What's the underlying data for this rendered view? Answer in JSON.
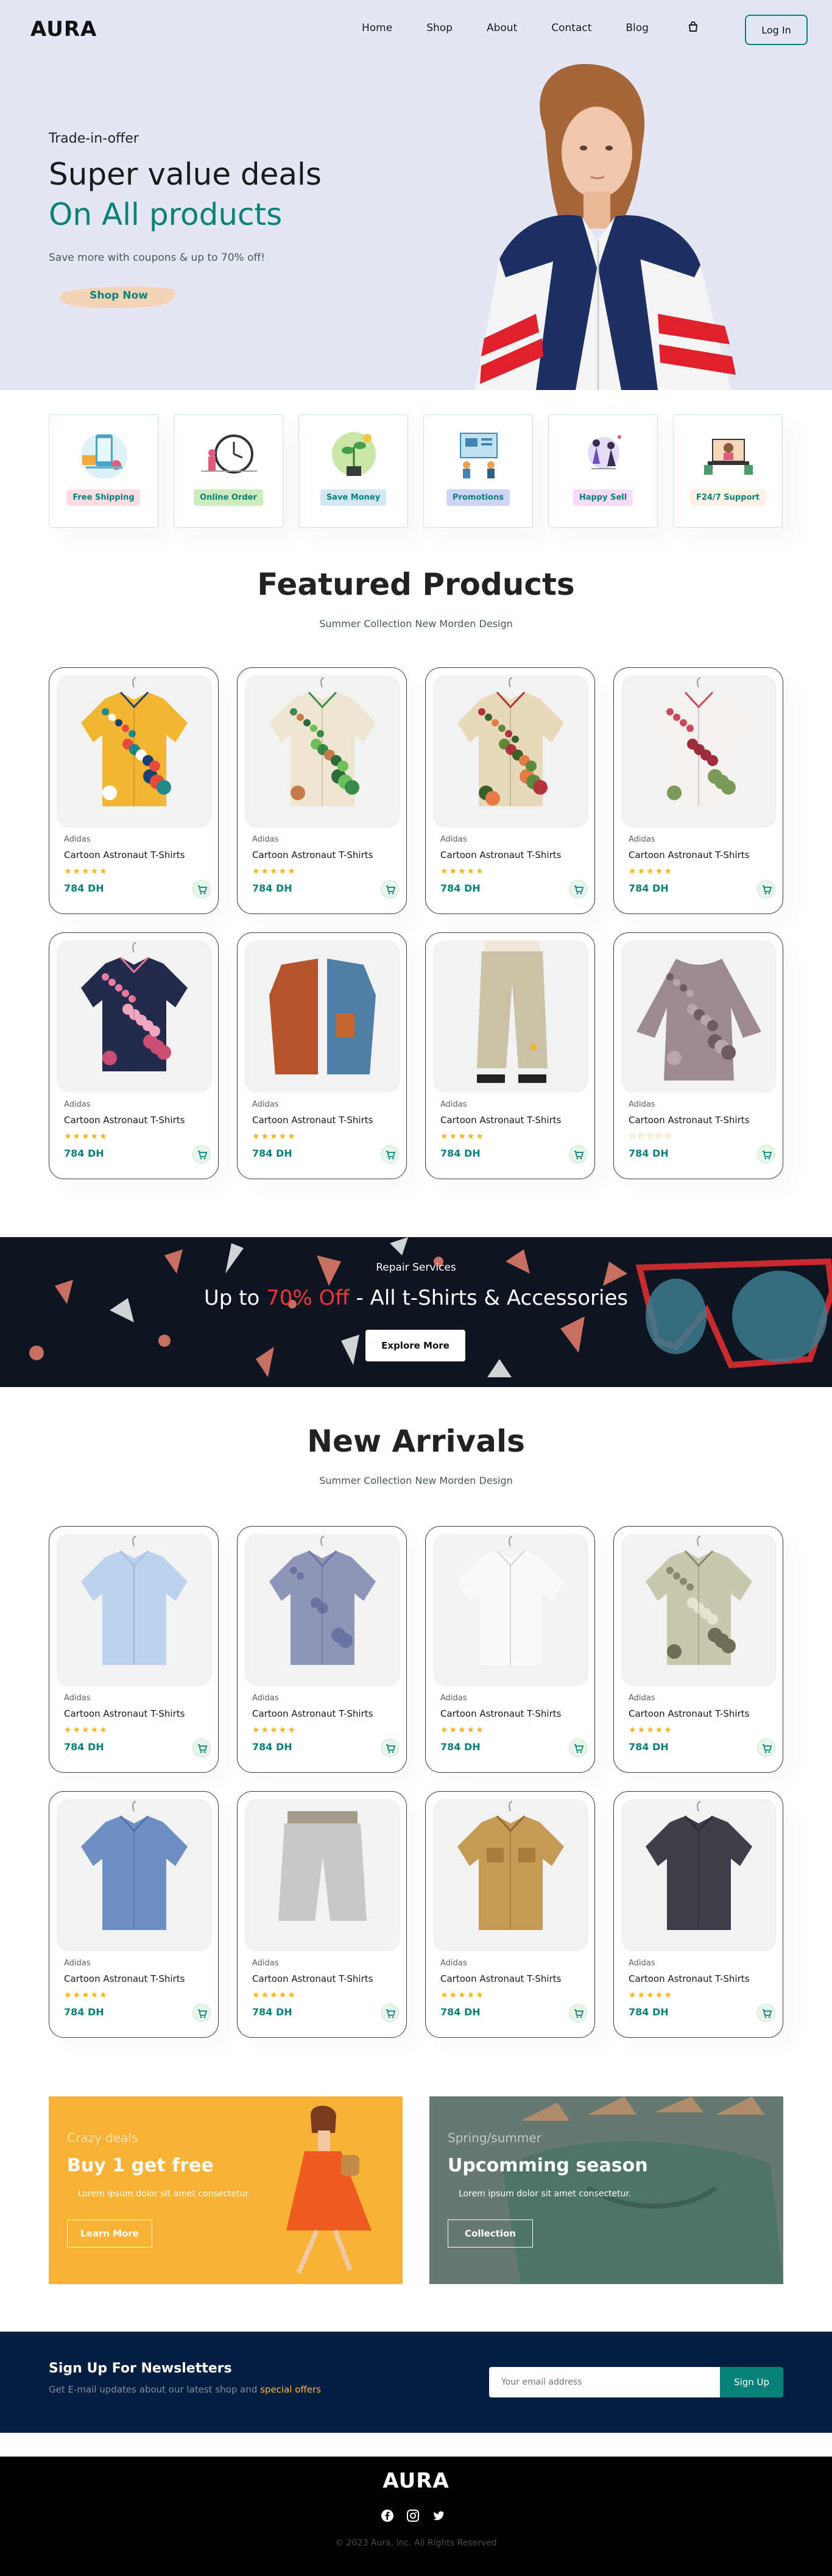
{
  "header": {
    "logo": "AURA",
    "nav": [
      "Home",
      "Shop",
      "About",
      "Contact",
      "Blog"
    ],
    "login_label": "Log In"
  },
  "hero": {
    "subtitle": "Trade-in-offer",
    "title_line1": "Super value deals",
    "title_line2": "On All products",
    "text": "Save more with coupons & up to 70% off!",
    "button": "Shop Now"
  },
  "features": [
    {
      "label": "Free Shipping",
      "bg": "#fddde4"
    },
    {
      "label": "Online Order",
      "bg": "#cdebbc"
    },
    {
      "label": "Save Money",
      "bg": "#d1e8f2"
    },
    {
      "label": "Promotions",
      "bg": "#cdd4f8"
    },
    {
      "label": "Happy Sell",
      "bg": "#f6dbf6"
    },
    {
      "label": "F24/7 Support",
      "bg": "#fff2e5"
    }
  ],
  "featured": {
    "title": "Featured Products",
    "subtitle": "Summer Collection New Morden Design",
    "products": [
      {
        "brand": "Adidas",
        "name": "Cartoon Astronaut T-Shirts",
        "stars": "★★★★★",
        "price": "784 DH",
        "icon": "shirt-yellow-teal"
      },
      {
        "brand": "Adidas",
        "name": "Cartoon Astronaut T-Shirts",
        "stars": "★★★★★",
        "price": "784 DH",
        "icon": "shirt-tropical-green"
      },
      {
        "brand": "Adidas",
        "name": "Cartoon Astronaut T-Shirts",
        "stars": "★★★★★",
        "price": "784 DH",
        "icon": "shirt-floral-beige"
      },
      {
        "brand": "Adidas",
        "name": "Cartoon Astronaut T-Shirts",
        "stars": "★★★★★",
        "price": "784 DH",
        "icon": "shirt-floral-white"
      },
      {
        "brand": "Adidas",
        "name": "Cartoon Astronaut T-Shirts",
        "stars": "★★★★★",
        "price": "784 DH",
        "icon": "shirt-navy-pink"
      },
      {
        "brand": "Adidas",
        "name": "Cartoon Astronaut T-Shirts",
        "stars": "★★★★★",
        "price": "784 DH",
        "icon": "shirt-rust-denim"
      },
      {
        "brand": "Adidas",
        "name": "Cartoon Astronaut T-Shirts",
        "stars": "★★★★★",
        "price": "784 DH",
        "icon": "pants-beige"
      },
      {
        "brand": "Adidas",
        "name": "Cartoon Astronaut T-Shirts",
        "stars": "☆☆☆☆☆",
        "price": "784 DH",
        "icon": "blouse-mauve"
      }
    ]
  },
  "banner": {
    "subtitle": "Repair Services",
    "title_pre": "Up to ",
    "title_highlight": "70% Off",
    "title_post": " - All t-Shirts & Accessories",
    "button": "Explore More"
  },
  "arrivals": {
    "title": "New Arrivals",
    "subtitle": "Summer Collection New Morden Design",
    "products": [
      {
        "brand": "Adidas",
        "name": "Cartoon Astronaut T-Shirts",
        "stars": "★★★★★",
        "price": "784 DH",
        "icon": "shirt-light-blue"
      },
      {
        "brand": "Adidas",
        "name": "Cartoon Astronaut T-Shirts",
        "stars": "★★★★★",
        "price": "784 DH",
        "icon": "shirt-blue-check"
      },
      {
        "brand": "Adidas",
        "name": "Cartoon Astronaut T-Shirts",
        "stars": "★★★★★",
        "price": "784 DH",
        "icon": "shirt-white"
      },
      {
        "brand": "Adidas",
        "name": "Cartoon Astronaut T-Shirts",
        "stars": "★★★★★",
        "price": "784 DH",
        "icon": "shirt-khaki-print"
      },
      {
        "brand": "Adidas",
        "name": "Cartoon Astronaut T-Shirts",
        "stars": "★★★★★",
        "price": "784 DH",
        "icon": "shirt-denim"
      },
      {
        "brand": "Adidas",
        "name": "Cartoon Astronaut T-Shirts",
        "stars": "★★★★★",
        "price": "784 DH",
        "icon": "shorts-grey"
      },
      {
        "brand": "Adidas",
        "name": "Cartoon Astronaut T-Shirts",
        "stars": "★★★★★",
        "price": "784 DH",
        "icon": "jacket-tan"
      },
      {
        "brand": "Adidas",
        "name": "Cartoon Astronaut T-Shirts",
        "stars": "★★★★★",
        "price": "784 DH",
        "icon": "shirt-charcoal"
      }
    ]
  },
  "promos": [
    {
      "small": "Crazy deals",
      "big": "Buy 1 get free",
      "text": "Lorem ipsum dolor sit amet consectetur.",
      "button": "Learn More"
    },
    {
      "small": "Spring/summer",
      "big": "Upcomming season",
      "text": "Lorem ipsum dolor sit amet consectetur.",
      "button": "Collection"
    }
  ],
  "newsletter": {
    "title": "Sign Up For Newsletters",
    "text_pre": "Get E-mail updates about our latest shop and ",
    "text_highlight": "special offers",
    "placeholder": "Your email address",
    "button": "Sign Up"
  },
  "footer": {
    "logo": "AURA",
    "copyright": "© 2023 Aura, Inc. All Rights Reserved"
  },
  "colors": {
    "accent": "#088178",
    "hero_bg": "#e3e6f3",
    "star": "#f3b519",
    "banner_highlight": "#ef3636",
    "newsletter_bg": "#041e42"
  }
}
